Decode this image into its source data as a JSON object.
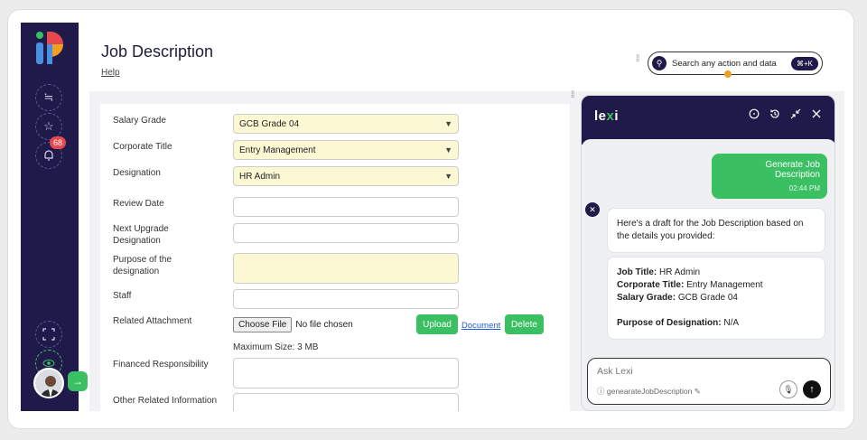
{
  "page": {
    "title": "Job Description",
    "help": "Help"
  },
  "sidebar": {
    "notification_count": "68"
  },
  "search": {
    "placeholder": "Search any action and data",
    "shortcut": "⌘+K"
  },
  "form": {
    "salary_grade": {
      "label": "Salary Grade",
      "value": "GCB Grade 04"
    },
    "corporate_title": {
      "label": "Corporate Title",
      "value": "Entry Management"
    },
    "designation": {
      "label": "Designation",
      "value": "HR Admin"
    },
    "review_date": {
      "label": "Review Date",
      "value": ""
    },
    "next_upgrade": {
      "label": "Next Upgrade Designation",
      "value": ""
    },
    "purpose": {
      "label": "Purpose of the designation",
      "value": ""
    },
    "staff": {
      "label": "Staff",
      "value": ""
    },
    "attachment": {
      "label": "Related Attachment",
      "choose_label": "Choose File",
      "file_status": "No file chosen",
      "upload_label": "Upload",
      "document_label": "Document",
      "delete_label": "Delete",
      "max_size": "Maximum Size: 3 MB"
    },
    "financed": {
      "label": "Financed Responsibility",
      "value": ""
    },
    "other": {
      "label": "Other Related Information",
      "value": ""
    }
  },
  "lexi": {
    "logo_main": "le",
    "logo_accent": "x",
    "logo_end": "i",
    "user_message": "Generate Job Description",
    "user_time": "02:44 PM",
    "bot_intro": "Here's a draft for the Job Description based on the details you provided:",
    "job_title_label": "Job Title:",
    "job_title_value": "HR Admin",
    "corp_title_label": "Corporate Title:",
    "corp_title_value": "Entry Management",
    "salary_label": "Salary Grade:",
    "salary_value": "GCB Grade 04",
    "purpose_label": "Purpose of Designation:",
    "purpose_value": "N/A",
    "input_placeholder": "Ask Lexi",
    "context": "genearateJobDescription"
  },
  "colors": {
    "sidebar": "#1f1a4a",
    "accent_green": "#3bbf63",
    "select_bg": "#fdf8d4"
  }
}
